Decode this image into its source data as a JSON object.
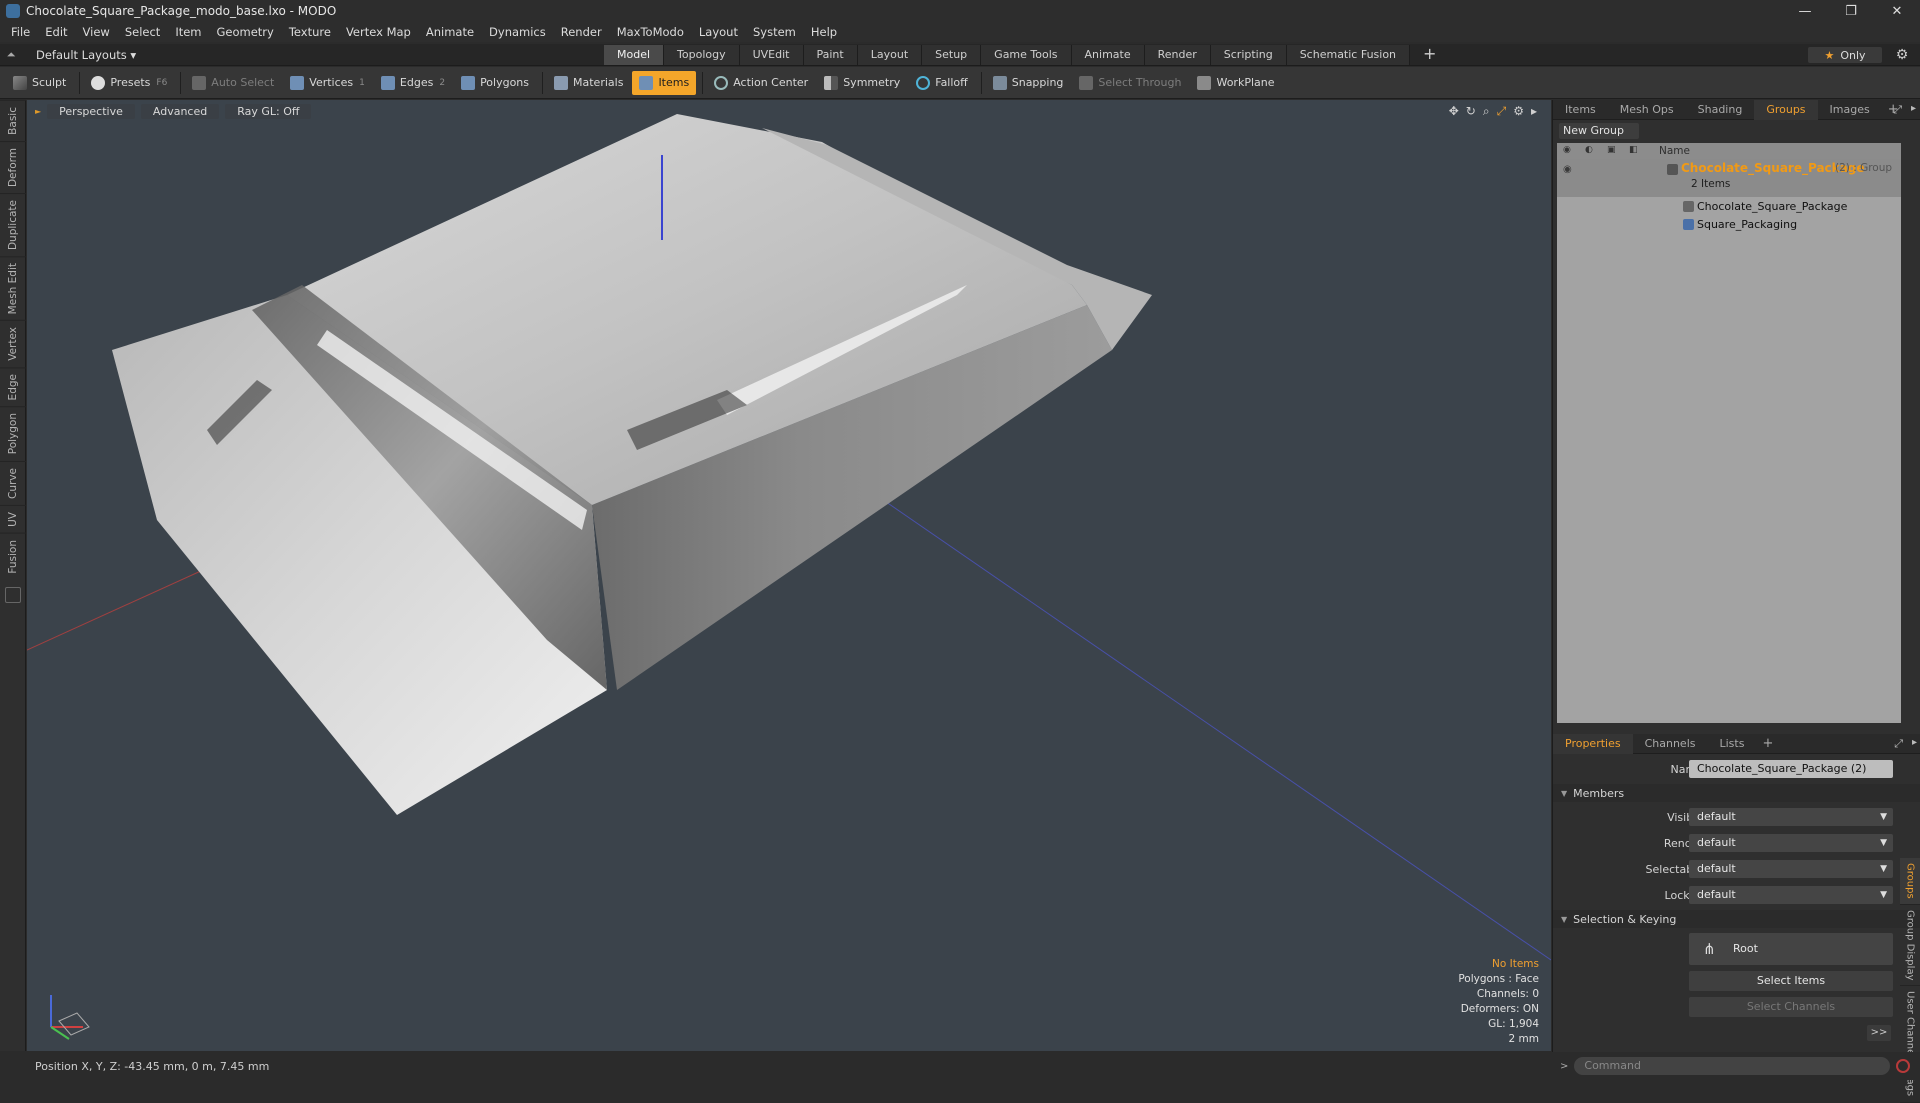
{
  "window": {
    "title": "Chocolate_Square_Package_modo_base.lxo - MODO",
    "controls": [
      "—",
      "❐",
      "✕"
    ]
  },
  "menu": [
    "File",
    "Edit",
    "View",
    "Select",
    "Item",
    "Geometry",
    "Texture",
    "Vertex Map",
    "Animate",
    "Dynamics",
    "Render",
    "MaxToModo",
    "Layout",
    "System",
    "Help"
  ],
  "layout_bar": {
    "layouts_label": "Default Layouts ▾",
    "tabs": [
      "Model",
      "Topology",
      "UVEdit",
      "Paint",
      "Layout",
      "Setup",
      "Game Tools",
      "Animate",
      "Render",
      "Scripting",
      "Schematic Fusion"
    ],
    "active_tab": "Model",
    "plus": "+",
    "only_label": "Only"
  },
  "toolbar": {
    "sculpt": "Sculpt",
    "presets": "Presets",
    "presets_key": "F6",
    "auto_select": "Auto Select",
    "vertices": "Vertices",
    "vertices_count": "1",
    "edges": "Edges",
    "edges_count": "2",
    "polygons": "Polygons",
    "materials": "Materials",
    "items": "Items",
    "action_center": "Action Center",
    "symmetry": "Symmetry",
    "falloff": "Falloff",
    "snapping": "Snapping",
    "select_through": "Select Through",
    "workplane": "WorkPlane"
  },
  "left_tabs": [
    "Basic",
    "Deform",
    "Duplicate",
    "Mesh Edit",
    "Vertex",
    "Edge",
    "Polygon",
    "Curve",
    "UV",
    "Fusion"
  ],
  "viewport": {
    "perspective": "Perspective",
    "advanced": "Advanced",
    "raygl": "Ray GL: Off",
    "info": {
      "no_items": "No Items",
      "polygons": "Polygons : Face",
      "channels": "Channels: 0",
      "deformers": "Deformers: ON",
      "gl": "GL: 1,904",
      "scale": "2 mm"
    }
  },
  "status": {
    "position": "Position X, Y, Z:  -43.45 mm, 0 m, 7.45 mm"
  },
  "right_panel": {
    "top_tabs": [
      "Items",
      "Mesh Ops",
      "Shading",
      "Groups",
      "Images"
    ],
    "active_top_tab": "Groups",
    "new_group": "New Group",
    "list_header": "Name",
    "group": {
      "name": "Chocolate_Square_Package",
      "count": "(2) : Group",
      "items": "2 Items",
      "children": [
        "Chocolate_Square_Package",
        "Square_Packaging"
      ]
    },
    "bottom_tabs": [
      "Properties",
      "Channels",
      "Lists"
    ],
    "active_bottom_tab": "Properties",
    "props": {
      "name_label": "Name",
      "name_value": "Chocolate_Square_Package (2)",
      "members_section": "Members",
      "visible_label": "Visible",
      "visible_value": "default",
      "render_label": "Render",
      "render_value": "default",
      "selectable_label": "Selectable",
      "selectable_value": "default",
      "locked_label": "Locked",
      "locked_value": "default",
      "selection_section": "Selection & Keying",
      "root_button": "Root",
      "select_items": "Select Items",
      "select_channels": "Select Channels",
      "more": ">>"
    },
    "side_tabs": [
      "Groups",
      "Group Display",
      "User Channels",
      "Tags"
    ],
    "command_placeholder": "Command"
  },
  "colors": {
    "accent": "#f4a62a",
    "viewport_bg": "#3b434b",
    "group_name": "#f19a15"
  }
}
